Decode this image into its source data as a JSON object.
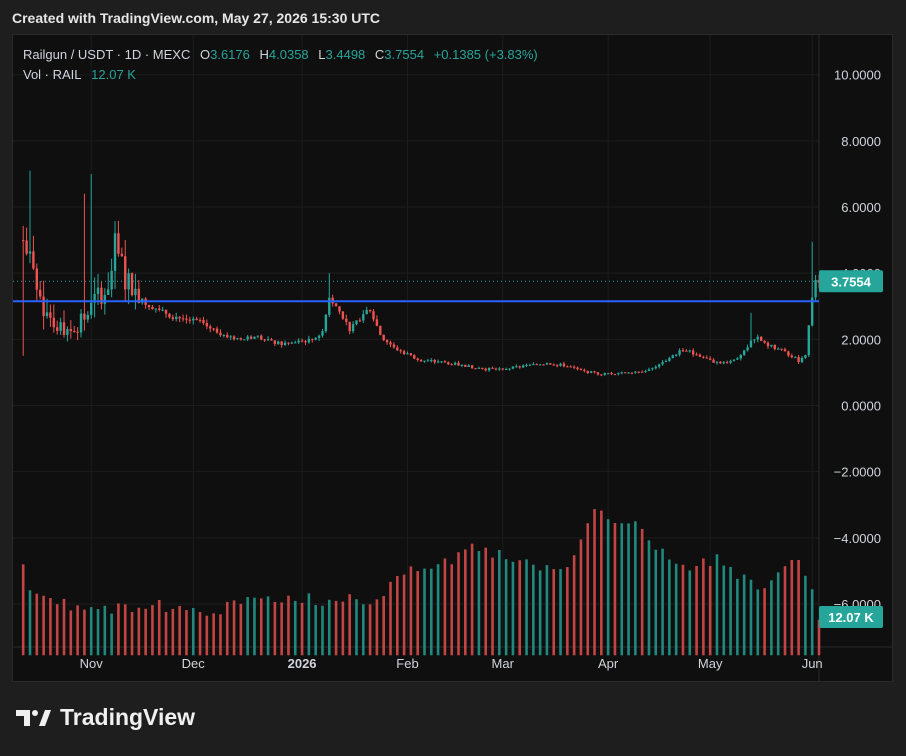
{
  "caption": "Created with TradingView.com, May 27, 2026 15:30 UTC",
  "legend": {
    "symbol": "Railgun / USDT · 1D · MEXC",
    "o_label": "O",
    "o_value": "3.6176",
    "h_label": "H",
    "h_value": "4.0358",
    "l_label": "L",
    "l_value": "3.4498",
    "c_label": "C",
    "c_value": "3.7554",
    "change": "+0.1385 (+3.83%)",
    "vol_label": "Vol · RAIL",
    "vol_value": "12.07 K"
  },
  "colors": {
    "up": "#26a69a",
    "down": "#ef5350",
    "hline": "#2962ff",
    "background": "#0f0f0f"
  },
  "brand": "TradingView",
  "chart_data": {
    "type": "candlestick",
    "y_ticks": [
      "10.0000",
      "8.0000",
      "6.0000",
      "4.0000",
      "2.0000",
      "0.0000",
      "−2.0000",
      "−4.0000",
      "−6.0000"
    ],
    "y_tick_values": [
      10,
      8,
      6,
      4,
      2,
      0,
      -2,
      -4,
      -6
    ],
    "ylim": [
      -7.3,
      11.2
    ],
    "x_ticks": [
      "Nov",
      "Dec",
      "2026",
      "Feb",
      "Mar",
      "Apr",
      "May",
      "Jun"
    ],
    "x_tick_bold": [
      false,
      false,
      true,
      false,
      false,
      false,
      false,
      false
    ],
    "x_tick_days": [
      20,
      50,
      82,
      113,
      141,
      172,
      202,
      232
    ],
    "day_range": [
      -3,
      234
    ],
    "last_price": "3.7554",
    "last_price_value": 3.7554,
    "last_volume": "12.07 K",
    "horizontal_line": 3.15,
    "price_path": [
      [
        0,
        5.0
      ],
      [
        2,
        4.3
      ],
      [
        4,
        3.5
      ],
      [
        6,
        3.0
      ],
      [
        10,
        2.4
      ],
      [
        14,
        2.3
      ],
      [
        18,
        2.6
      ],
      [
        22,
        3.3
      ],
      [
        25,
        3.7
      ],
      [
        27,
        4.7
      ],
      [
        28,
        4.5
      ],
      [
        30,
        3.8
      ],
      [
        33,
        3.5
      ],
      [
        36,
        3.1
      ],
      [
        40,
        2.9
      ],
      [
        44,
        2.7
      ],
      [
        48,
        2.6
      ],
      [
        52,
        2.5
      ],
      [
        56,
        2.3
      ],
      [
        60,
        2.1
      ],
      [
        64,
        2.0
      ],
      [
        68,
        2.1
      ],
      [
        72,
        1.95
      ],
      [
        76,
        1.85
      ],
      [
        80,
        1.9
      ],
      [
        85,
        2.0
      ],
      [
        88,
        2.2
      ],
      [
        90,
        3.3
      ],
      [
        92,
        3.0
      ],
      [
        94,
        2.7
      ],
      [
        96,
        2.3
      ],
      [
        98,
        2.5
      ],
      [
        100,
        2.8
      ],
      [
        102,
        2.9
      ],
      [
        104,
        2.4
      ],
      [
        106,
        2.0
      ],
      [
        110,
        1.7
      ],
      [
        114,
        1.5
      ],
      [
        118,
        1.35
      ],
      [
        124,
        1.3
      ],
      [
        130,
        1.2
      ],
      [
        136,
        1.1
      ],
      [
        142,
        1.12
      ],
      [
        148,
        1.2
      ],
      [
        154,
        1.28
      ],
      [
        160,
        1.2
      ],
      [
        164,
        1.05
      ],
      [
        170,
        0.95
      ],
      [
        176,
        1.0
      ],
      [
        182,
        1.05
      ],
      [
        186,
        1.15
      ],
      [
        190,
        1.45
      ],
      [
        194,
        1.7
      ],
      [
        198,
        1.55
      ],
      [
        202,
        1.35
      ],
      [
        206,
        1.3
      ],
      [
        210,
        1.45
      ],
      [
        214,
        1.9
      ],
      [
        216,
        2.05
      ],
      [
        218,
        1.85
      ],
      [
        222,
        1.7
      ],
      [
        226,
        1.5
      ],
      [
        228,
        1.35
      ],
      [
        230,
        1.55
      ],
      [
        231,
        2.4
      ],
      [
        232,
        3.3
      ],
      [
        233,
        3.8
      ],
      [
        234,
        3.6
      ],
      [
        235,
        3.75
      ]
    ],
    "volume_path": [
      [
        0,
        -4.7
      ],
      [
        2,
        -5.5
      ],
      [
        6,
        -5.6
      ],
      [
        12,
        -6.0
      ],
      [
        20,
        -6.2
      ],
      [
        28,
        -6.1
      ],
      [
        36,
        -6.0
      ],
      [
        44,
        -6.1
      ],
      [
        52,
        -6.2
      ],
      [
        60,
        -6.1
      ],
      [
        68,
        -5.9
      ],
      [
        76,
        -6.0
      ],
      [
        82,
        -5.8
      ],
      [
        90,
        -5.9
      ],
      [
        98,
        -5.9
      ],
      [
        104,
        -5.8
      ],
      [
        108,
        -5.4
      ],
      [
        112,
        -5.0
      ],
      [
        118,
        -4.9
      ],
      [
        126,
        -4.6
      ],
      [
        134,
        -4.3
      ],
      [
        142,
        -4.6
      ],
      [
        150,
        -4.8
      ],
      [
        158,
        -5.0
      ],
      [
        164,
        -4.2
      ],
      [
        168,
        -3.3
      ],
      [
        172,
        -3.3
      ],
      [
        178,
        -3.6
      ],
      [
        182,
        -3.7
      ],
      [
        186,
        -4.2
      ],
      [
        190,
        -4.8
      ],
      [
        196,
        -5.0
      ],
      [
        200,
        -4.8
      ],
      [
        204,
        -4.6
      ],
      [
        208,
        -4.9
      ],
      [
        212,
        -5.2
      ],
      [
        216,
        -5.5
      ],
      [
        220,
        -5.3
      ],
      [
        224,
        -4.9
      ],
      [
        228,
        -4.8
      ],
      [
        230,
        -5.3
      ],
      [
        232,
        -5.7
      ],
      [
        234,
        -6.6
      ]
    ]
  }
}
